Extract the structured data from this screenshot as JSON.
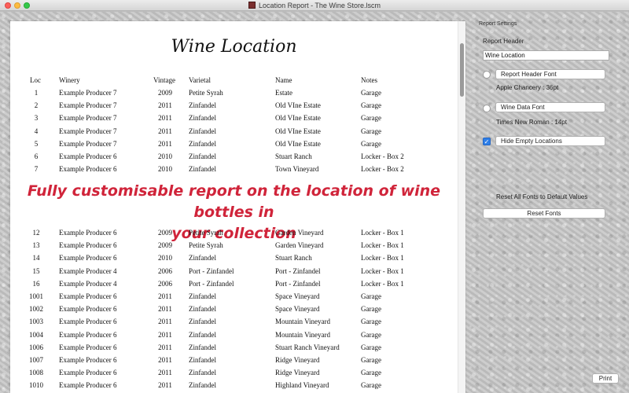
{
  "window": {
    "title": "Location Report - The Wine Store.lscm"
  },
  "report": {
    "title": "Wine Location",
    "columns": [
      "Loc",
      "Winery",
      "Vintage",
      "Varietal",
      "Name",
      "Notes"
    ],
    "rows_top": [
      {
        "loc": "1",
        "winery": "Example Producer 7",
        "vintage": "2009",
        "varietal": "Petite Syrah",
        "name": "Estate",
        "notes": "Garage"
      },
      {
        "loc": "2",
        "winery": "Example Producer 7",
        "vintage": "2011",
        "varietal": "Zinfandel",
        "name": "Old VIne Estate",
        "notes": "Garage"
      },
      {
        "loc": "3",
        "winery": "Example Producer 7",
        "vintage": "2011",
        "varietal": "Zinfandel",
        "name": "Old VIne Estate",
        "notes": "Garage"
      },
      {
        "loc": "4",
        "winery": "Example Producer 7",
        "vintage": "2011",
        "varietal": "Zinfandel",
        "name": "Old VIne Estate",
        "notes": "Garage"
      },
      {
        "loc": "5",
        "winery": "Example Producer 7",
        "vintage": "2011",
        "varietal": "Zinfandel",
        "name": "Old VIne Estate",
        "notes": "Garage"
      },
      {
        "loc": "6",
        "winery": "Example Producer 6",
        "vintage": "2010",
        "varietal": "Zinfandel",
        "name": "Stuart Ranch",
        "notes": "Locker - Box 2"
      },
      {
        "loc": "7",
        "winery": "Example Producer 6",
        "vintage": "2010",
        "varietal": "Zinfandel",
        "name": "Town Vineyard",
        "notes": "Locker - Box 2"
      }
    ],
    "rows_bottom": [
      {
        "loc": "12",
        "winery": "Example Producer 6",
        "vintage": "2009",
        "varietal": "Petite Syrah",
        "name": "Garden Vineyard",
        "notes": "Locker - Box 1"
      },
      {
        "loc": "13",
        "winery": "Example Producer 6",
        "vintage": "2009",
        "varietal": "Petite Syrah",
        "name": "Garden Vineyard",
        "notes": "Locker - Box 1"
      },
      {
        "loc": "14",
        "winery": "Example Producer 6",
        "vintage": "2010",
        "varietal": "Zinfandel",
        "name": "Stuart Ranch",
        "notes": "Locker - Box 1"
      },
      {
        "loc": "15",
        "winery": "Example Producer 4",
        "vintage": "2006",
        "varietal": "Port - Zinfandel",
        "name": "Port - Zinfandel",
        "notes": "Locker - Box 1"
      },
      {
        "loc": "16",
        "winery": "Example Producer 4",
        "vintage": "2006",
        "varietal": "Port - Zinfandel",
        "name": "Port - Zinfandel",
        "notes": "Locker - Box 1"
      },
      {
        "loc": "1001",
        "winery": "Example Producer 6",
        "vintage": "2011",
        "varietal": "Zinfandel",
        "name": "Space Vineyard",
        "notes": "Garage"
      },
      {
        "loc": "1002",
        "winery": "Example Producer 6",
        "vintage": "2011",
        "varietal": "Zinfandel",
        "name": "Space Vineyard",
        "notes": "Garage"
      },
      {
        "loc": "1003",
        "winery": "Example Producer 6",
        "vintage": "2011",
        "varietal": "Zinfandel",
        "name": "Mountain Vineyard",
        "notes": "Garage"
      },
      {
        "loc": "1004",
        "winery": "Example Producer 6",
        "vintage": "2011",
        "varietal": "Zinfandel",
        "name": "Mountain Vineyard",
        "notes": "Garage"
      },
      {
        "loc": "1006",
        "winery": "Example Producer 6",
        "vintage": "2011",
        "varietal": "Zinfandel",
        "name": "Stuart Ranch Vineyard",
        "notes": "Garage"
      },
      {
        "loc": "1007",
        "winery": "Example Producer 6",
        "vintage": "2011",
        "varietal": "Zinfandel",
        "name": "Ridge Vineyard",
        "notes": "Garage"
      },
      {
        "loc": "1008",
        "winery": "Example Producer 6",
        "vintage": "2011",
        "varietal": "Zinfandel",
        "name": "Ridge Vineyard",
        "notes": "Garage"
      },
      {
        "loc": "1010",
        "winery": "Example Producer 6",
        "vintage": "2011",
        "varietal": "Zinfandel",
        "name": "Highland Vineyard",
        "notes": "Garage"
      }
    ]
  },
  "overlay": {
    "line1": "Fully customisable report on the location of wine bottles in",
    "line2": "your collection",
    "color": "#d0243a"
  },
  "settings": {
    "caption": "Report Settings",
    "header_label": "Report Header",
    "header_value": "Wine Location",
    "header_font_button": "Report Header Font",
    "header_font_desc": "Apple Chancery : 36pt",
    "data_font_button": "Wine Data Font",
    "data_font_desc": "Times New Roman : 14pt",
    "hide_empty_label": "Hide Empty Locations",
    "hide_empty_checked": true,
    "reset_desc": "Reset All Fonts to Default Values",
    "reset_button": "Reset Fonts",
    "print_button": "Print"
  }
}
